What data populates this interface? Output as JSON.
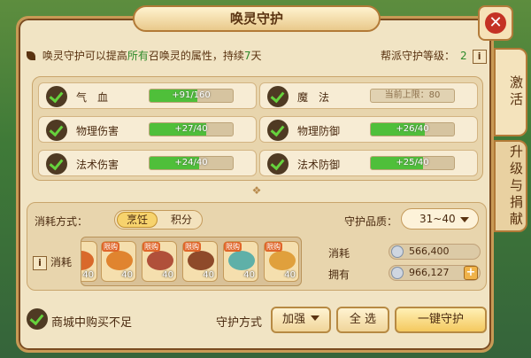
{
  "window": {
    "title": "唤灵守护",
    "close_label": "✕"
  },
  "side_tabs": [
    {
      "label": "激活"
    },
    {
      "label": "升级与捐献"
    }
  ],
  "description": {
    "prefix": "唤灵守护可以提高",
    "highlight": "所有",
    "middle": "召唤灵的属性，持续",
    "days": "7",
    "suffix": "天"
  },
  "sect_level": {
    "label": "帮派守护等级：",
    "value": "2",
    "info_label": "i"
  },
  "stats": [
    {
      "name": "气　血",
      "bar_text": "+91/160",
      "progress": 0.57,
      "checked": true
    },
    {
      "name": "魔　法",
      "bar_text": "当前上限：80",
      "progress": 0,
      "checked": true
    },
    {
      "name": "物理伤害",
      "bar_text": "+27/40",
      "progress": 0.68,
      "checked": true
    },
    {
      "name": "物理防御",
      "bar_text": "+26/40",
      "progress": 0.65,
      "checked": true
    },
    {
      "name": "法术伤害",
      "bar_text": "+24/40",
      "progress": 0.6,
      "checked": true
    },
    {
      "name": "法术防御",
      "bar_text": "+25/40",
      "progress": 0.63,
      "checked": true
    }
  ],
  "consume": {
    "method_label": "消耗方式：",
    "method_options": [
      "烹饪",
      "积分"
    ],
    "quality_label": "守护品质：",
    "quality_value": "31~40",
    "consume_label": "消耗",
    "info_label": "i",
    "foods": [
      {
        "tag": "",
        "count": "40",
        "color": "#d9692b"
      },
      {
        "tag": "限购",
        "count": "40",
        "color": "#e0842f"
      },
      {
        "tag": "限购",
        "count": "40",
        "color": "#b0503a"
      },
      {
        "tag": "限购",
        "count": "40",
        "color": "#8e4a2a"
      },
      {
        "tag": "限购",
        "count": "40",
        "color": "#5fb0a8"
      },
      {
        "tag": "限购",
        "count": "40",
        "color": "#e0a03c"
      }
    ],
    "cost_label": "消耗",
    "cost_value": "566,400",
    "own_label": "拥有",
    "own_value": "966,127",
    "add_label": "+"
  },
  "bottom": {
    "insufficient_label": "商城中购买不足",
    "mode_label": "守护方式",
    "mode_value": "加强",
    "select_all": "全 选",
    "one_click": "一键守护"
  },
  "colors": {
    "accent_green": "#4fbf3a",
    "panel": "#f1e4c4",
    "close_red": "#c43224"
  }
}
